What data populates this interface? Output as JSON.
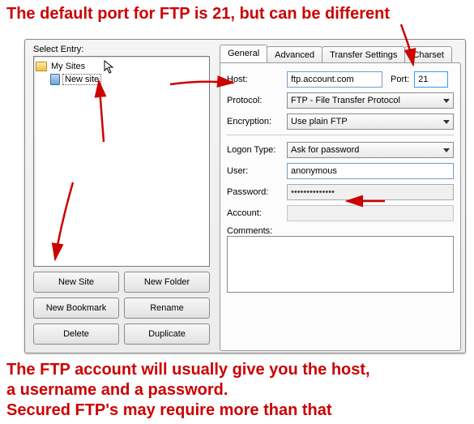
{
  "annotations": {
    "top": "The default port for FTP is 21, but can be different",
    "bottom_line1": "The FTP account will usually give you the host,",
    "bottom_line2": " a username and a password.",
    "bottom_line3": " Secured FTP's may require more than that"
  },
  "left": {
    "select_entry_label": "Select Entry:",
    "root_label": "My Sites",
    "child_label": "New site",
    "buttons": {
      "new_site": "New Site",
      "new_folder": "New Folder",
      "new_bookmark": "New Bookmark",
      "rename": "Rename",
      "delete": "Delete",
      "duplicate": "Duplicate"
    }
  },
  "tabs": {
    "general": "General",
    "advanced": "Advanced",
    "transfer": "Transfer Settings",
    "charset": "Charset"
  },
  "form": {
    "host_label": "Host:",
    "host_value": "ftp.account.com",
    "port_label": "Port:",
    "port_value": "21",
    "protocol_label": "Protocol:",
    "protocol_value": "FTP - File Transfer Protocol",
    "encryption_label": "Encryption:",
    "encryption_value": "Use plain FTP",
    "logon_label": "Logon Type:",
    "logon_value": "Ask for password",
    "user_label": "User:",
    "user_value": "anonymous",
    "password_label": "Password:",
    "password_value": "••••••••••••••",
    "account_label": "Account:",
    "account_value": "",
    "comments_label": "Comments:",
    "comments_value": ""
  }
}
